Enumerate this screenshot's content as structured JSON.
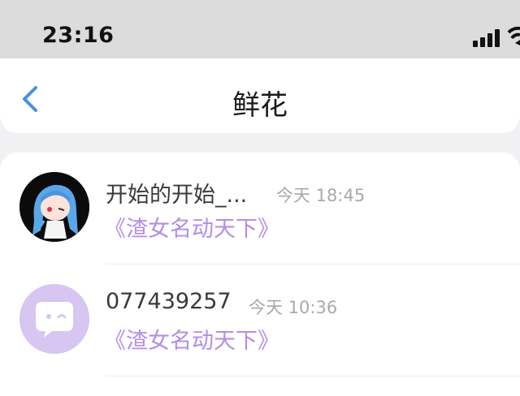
{
  "status_bar": {
    "time": "23:16"
  },
  "header": {
    "title": "鲜花"
  },
  "conversations": [
    {
      "name": "开始的开始_...",
      "timestamp": "今天 18:45",
      "preview": "《渣女名动天下》",
      "avatar": "anime-avatar"
    },
    {
      "name": "077439257",
      "timestamp": "今天 10:36",
      "preview": "《渣女名动天下》",
      "avatar": "default-chat-avatar"
    }
  ],
  "colors": {
    "accent": "#4a90e2",
    "preview_text": "#b48ce6",
    "default_avatar_bg": "#d7c5f2"
  }
}
